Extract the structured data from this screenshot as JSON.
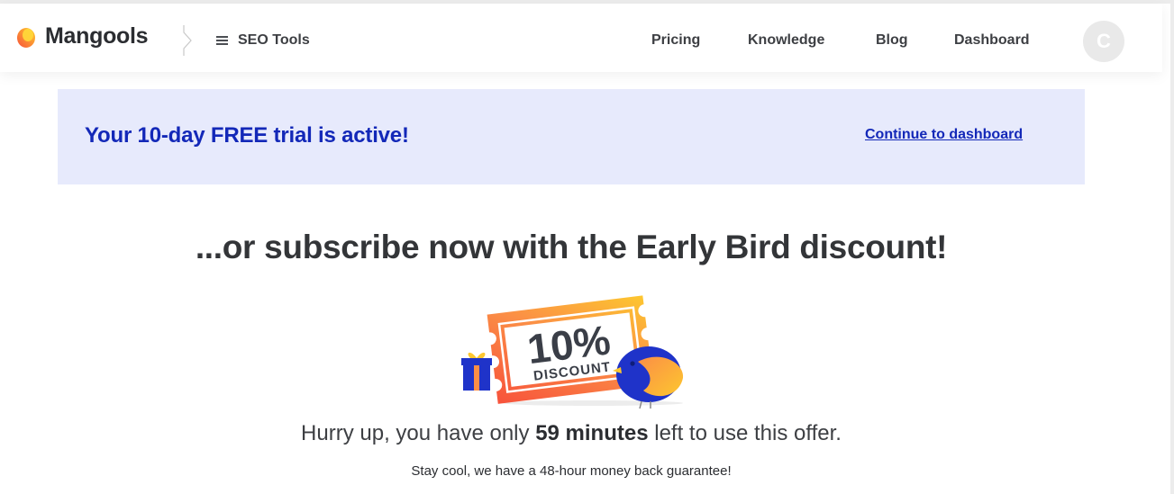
{
  "header": {
    "brand": "Mangools",
    "tools_label": "SEO Tools",
    "nav": [
      "Pricing",
      "Knowledge",
      "Blog",
      "Dashboard"
    ],
    "avatar_initial": "C"
  },
  "banner": {
    "title": "Your 10-day FREE trial is active!",
    "link": "Continue to dashboard"
  },
  "offer": {
    "headline": "...or subscribe now with the Early Bird discount!",
    "ticket_percent": "10%",
    "ticket_word": "DISCOUNT",
    "hurry_prefix": "Hurry up, you have only",
    "hurry_time": "59 minutes",
    "hurry_suffix": "left to use this offer.",
    "guarantee": "Stay cool, we have a 48-hour money back guarantee!"
  },
  "colors": {
    "accent_blue": "#1328b8",
    "banner_bg": "#e7eafc",
    "ticket_orange": "#fa8a4f",
    "ticket_yellow": "#fbc535"
  },
  "icons": [
    "mangools-logo-icon",
    "breadcrumb-chevron-icon",
    "menu-icon",
    "gift-icon",
    "bird-icon"
  ]
}
